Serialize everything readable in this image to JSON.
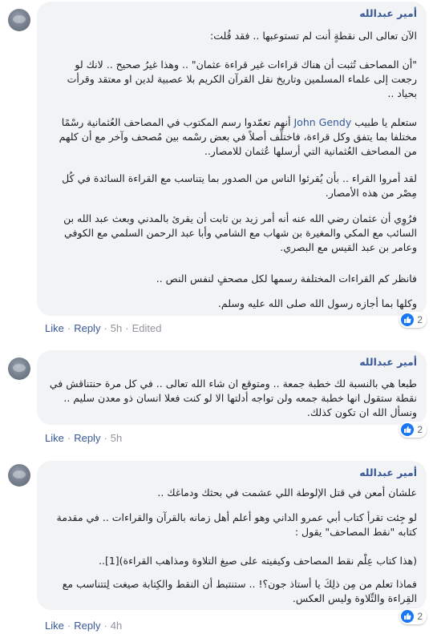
{
  "comments": [
    {
      "author": "أمير عبدالله",
      "paragraphs": [
        "الآن تعالى الى نقطةٍ أنت لم تستوعبها .. فقد قُلت:",
        "\"أن المصاحف تُثبت أن هناك قراءات غير قراءة عثمان\" .. وهذا غيرُ صحيح .. لانك لو رجعت إلى علماء المسلمين وتاريخ نقل القرآن الكريم بلا عصبية لدين او معتقد وقرأت بحياد ..",
        "ستعلم يا طبيب John Gendy أنهم تعمّدوا رسم المكتوب في المصاحف العُثمانية رسْمًا مختلفا بما يتفق وكل قراءة، فاختلِّف أصلاً في بعض رسْمه بين مُصحف وآخر مع أن كلهم من المصاحف العُثمانية التي أرسلها عُثمان للامصار..",
        "لقد أمروا القراء .. بأن يُقرئوا الناس من الصدور بما يتناسب مع القراءة السائدة في كُل مِصْر من هذه الأمصار.",
        "فرُوِي أن عثمان رضي الله عنه أنه أمر زيد بن ثابت أن يقرئ بالمدني وبعث عبد الله بن السائب مع المكي والمغيرة بن شهاب مع الشامي وأبا عبد الرحمن السلمي مع الكوفي وعامر بن عبد القيس مع البصري.",
        "فانظر كم القراءات المختلفة رسمها لكل مصحفٍ لنفس النص ..",
        "وكلها بما أجازه رسول الله صلى الله عليه وسلم."
      ],
      "mention": "John Gendy",
      "actions": {
        "like": "Like",
        "reply": "Reply",
        "time": "5h",
        "edited": "Edited"
      },
      "reactions": {
        "icon": "like-thumb-icon",
        "count": "2"
      }
    },
    {
      "author": "أمير عبدالله",
      "paragraphs": [
        "طبعا هي بالنسبة لك خطبة جمعة .. ومتوقع ان شاء الله تعالى .. في كل مرة حنتناقش في نقطة ستقول انها خطبة جمعه ولن تواجه أدلتها الا لو كنت فعلا انسان ذو معدن سليم .. ونسأل الله ان تكون كذلك."
      ],
      "actions": {
        "like": "Like",
        "reply": "Reply",
        "time": "5h"
      },
      "reactions": {
        "icon": "like-thumb-icon",
        "count": "2"
      }
    },
    {
      "author": "أمير عبدالله",
      "paragraphs": [
        "علشان أمعن في قتل الإلوطة اللي عشمت في بحثك ودماغك ..",
        "لو جِئت تقرأ كتاب أبي عمرو الداني وهو أعلم أهل زمانه بالقرآن والقراءات .. في مقدمة كتابه \"نقط المصاحف\" يقول :",
        "(هذا كتاب عِلْم نقط المصاحف وكيفيته على صيغ التلاوة ومذاهب القراءة)[1]..",
        "فماذا تعلم من مِن ذلِكَ يا أستاذ جون؟! .. ستنتبط أن النقط والكِتابة صيغت لِتتناسب مع القِراءة والتِّلاوة وليس العكس."
      ],
      "actions": {
        "like": "Like",
        "reply": "Reply",
        "time": "4h"
      },
      "reactions": {
        "icon": "like-thumb-icon",
        "count": "2"
      }
    }
  ],
  "colors": {
    "link": "#385898",
    "bubble": "#f2f3f5",
    "like_blue": "#1877f2",
    "meta": "#90949c"
  }
}
